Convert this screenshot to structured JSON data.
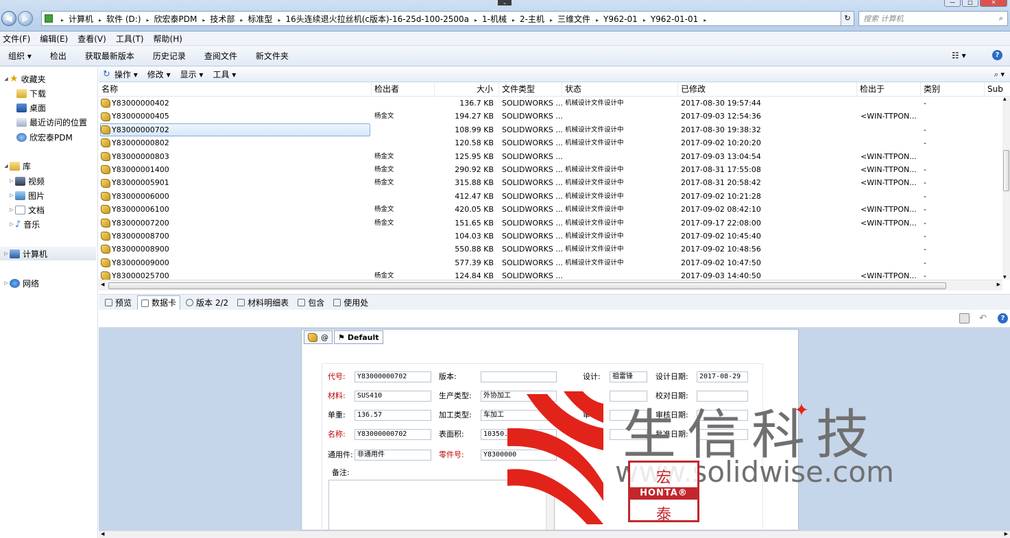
{
  "address": {
    "crumbs": [
      "计算机",
      "软件 (D:)",
      "欣宏泰PDM",
      "技术部",
      "标准型",
      "16头连续退火拉丝机(c版本)-16-25d-100-2500a",
      "1-机械",
      "2-主机",
      "三维文件",
      "Y962-01",
      "Y962-01-01"
    ],
    "search_placeholder": "搜索 计算机"
  },
  "menu": [
    "文件(F)",
    "编辑(E)",
    "查看(V)",
    "工具(T)",
    "帮助(H)"
  ],
  "commands": [
    "组织 ▾",
    "检出",
    "获取最新版本",
    "历史记录",
    "查阅文件",
    "新文件夹"
  ],
  "nav": {
    "favorites": "收藏夹",
    "fav_items": [
      "下载",
      "桌面",
      "最近访问的位置",
      "欣宏泰PDM"
    ],
    "library": "库",
    "lib_items": [
      "视频",
      "图片",
      "文档",
      "音乐"
    ],
    "computer": "计算机",
    "network": "网络"
  },
  "pdm_toolbar": [
    "操作 ▾",
    "修改 ▾",
    "显示 ▾",
    "工具 ▾"
  ],
  "columns": [
    "名称",
    "检出者",
    "大小",
    "文件类型",
    "状态",
    "已修改",
    "检出于",
    "类别",
    "Sub"
  ],
  "files": [
    {
      "name": "Y83000000402",
      "checked_out_by": "",
      "size": "136.7 KB",
      "type": "SOLIDWORKS ...",
      "state": "机械设计文件设计中",
      "modified": "2017-08-30 19:57:44",
      "checked_out_on": "",
      "category": "-"
    },
    {
      "name": "Y83000000405",
      "checked_out_by": "杨金文",
      "size": "194.27 KB",
      "type": "SOLIDWORKS ...",
      "state": "",
      "modified": "2017-09-03 12:54:36",
      "checked_out_on": "<WIN-TTPON...",
      "category": ""
    },
    {
      "name": "Y83000000702",
      "checked_out_by": "",
      "size": "108.99 KB",
      "type": "SOLIDWORKS ...",
      "state": "机械设计文件设计中",
      "modified": "2017-08-30 19:38:32",
      "checked_out_on": "",
      "category": "-"
    },
    {
      "name": "Y83000000802",
      "checked_out_by": "",
      "size": "120.58 KB",
      "type": "SOLIDWORKS ...",
      "state": "机械设计文件设计中",
      "modified": "2017-09-02 10:20:20",
      "checked_out_on": "",
      "category": "-"
    },
    {
      "name": "Y83000000803",
      "checked_out_by": "杨金文",
      "size": "125.95 KB",
      "type": "SOLIDWORKS ...",
      "state": "",
      "modified": "2017-09-03 13:04:54",
      "checked_out_on": "<WIN-TTPON...",
      "category": ""
    },
    {
      "name": "Y83000001400",
      "checked_out_by": "杨金文",
      "size": "290.92 KB",
      "type": "SOLIDWORKS ...",
      "state": "机械设计文件设计中",
      "modified": "2017-08-31 17:55:08",
      "checked_out_on": "<WIN-TTPON...",
      "category": "-"
    },
    {
      "name": "Y83000005901",
      "checked_out_by": "杨金文",
      "size": "315.88 KB",
      "type": "SOLIDWORKS ...",
      "state": "机械设计文件设计中",
      "modified": "2017-08-31 20:58:42",
      "checked_out_on": "<WIN-TTPON...",
      "category": "-"
    },
    {
      "name": "Y83000006000",
      "checked_out_by": "",
      "size": "412.47 KB",
      "type": "SOLIDWORKS ...",
      "state": "机械设计文件设计中",
      "modified": "2017-09-02 10:21:28",
      "checked_out_on": "",
      "category": "-"
    },
    {
      "name": "Y83000006100",
      "checked_out_by": "杨金文",
      "size": "420.05 KB",
      "type": "SOLIDWORKS ...",
      "state": "机械设计文件设计中",
      "modified": "2017-09-02 08:42:10",
      "checked_out_on": "<WIN-TTPON...",
      "category": "-"
    },
    {
      "name": "Y83000007200",
      "checked_out_by": "杨金文",
      "size": "151.65 KB",
      "type": "SOLIDWORKS ...",
      "state": "机械设计文件设计中",
      "modified": "2017-09-17 22:08:00",
      "checked_out_on": "<WIN-TTPON...",
      "category": "-"
    },
    {
      "name": "Y83000008700",
      "checked_out_by": "",
      "size": "104.03 KB",
      "type": "SOLIDWORKS ...",
      "state": "机械设计文件设计中",
      "modified": "2017-09-02 10:45:40",
      "checked_out_on": "",
      "category": "-"
    },
    {
      "name": "Y83000008900",
      "checked_out_by": "",
      "size": "550.88 KB",
      "type": "SOLIDWORKS ...",
      "state": "机械设计文件设计中",
      "modified": "2017-09-02 10:48:56",
      "checked_out_on": "",
      "category": "-"
    },
    {
      "name": "Y83000009000",
      "checked_out_by": "",
      "size": "577.39 KB",
      "type": "SOLIDWORKS ...",
      "state": "机械设计文件设计中",
      "modified": "2017-09-02 10:47:50",
      "checked_out_on": "",
      "category": "-"
    },
    {
      "name": "Y83000025700",
      "checked_out_by": "杨金文",
      "size": "124.84 KB",
      "type": "SOLIDWORKS ...",
      "state": "",
      "modified": "2017-09-03 14:40:50",
      "checked_out_on": "<WIN-TTPON...",
      "category": "-"
    }
  ],
  "selected_index": 2,
  "tabs": [
    "预览",
    "数据卡",
    "版本 2/2",
    "材料明细表",
    "包含",
    "使用处"
  ],
  "card": {
    "tab_at": "@",
    "tab_default": "Default",
    "labels": {
      "code": "代号:",
      "version": "版本:",
      "design": "设计:",
      "design_date": "设计日期:",
      "material": "材料:",
      "prod_type": "生产类型:",
      "check_date": "校对日期:",
      "weight": "单重:",
      "proc_type": "加工类型:",
      "review": "审",
      "review_date": "审核日期:",
      "name": "名称:",
      "surface": "表面积:",
      "approve": "批准",
      "approve_date": "批准日期:",
      "common": "通用件:",
      "part_no": "零件号:",
      "remark": "备注:"
    },
    "values": {
      "code": "Y83000000702",
      "version": "",
      "designer": "祖雷锋",
      "design_date": "2017-08-29",
      "material": "SUS410",
      "prod_type": "外协加工",
      "check_date": "",
      "weight": "136.57",
      "proc_type": "车加工",
      "name": "Y83000000702",
      "surface": "10350.40",
      "common": "非通用件",
      "part_no": "Y8300000"
    }
  },
  "watermark": {
    "company_cn": "生信科技",
    "url": "www.solidwise.com",
    "seal_text": "HONTA®",
    "seal_char_top": "宏",
    "seal_char_bottom": "泰",
    "colors": {
      "red": "#e2231a",
      "gray": "#707070"
    }
  }
}
